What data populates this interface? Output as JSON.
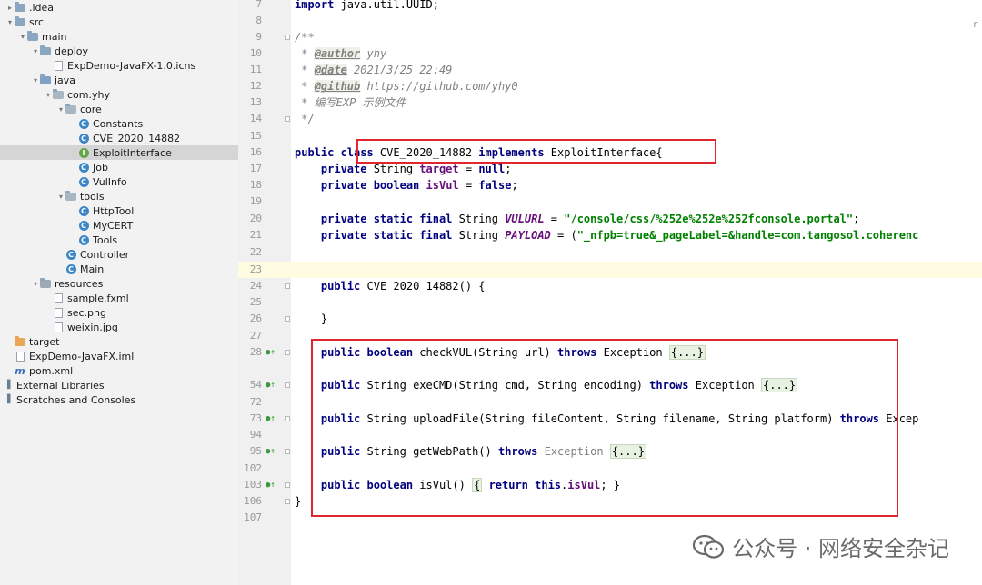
{
  "project_tree": [
    {
      "label": ".idea",
      "type": "folder",
      "depth": 0,
      "arrow": "right"
    },
    {
      "label": "src",
      "type": "folder",
      "depth": 0,
      "arrow": "down"
    },
    {
      "label": "main",
      "type": "folder",
      "depth": 1,
      "arrow": "down"
    },
    {
      "label": "deploy",
      "type": "folder",
      "depth": 2,
      "arrow": "down"
    },
    {
      "label": "ExpDemo-JavaFX-1.0.icns",
      "type": "file",
      "depth": 3,
      "arrow": ""
    },
    {
      "label": "java",
      "type": "src",
      "depth": 2,
      "arrow": "down"
    },
    {
      "label": "com.yhy",
      "type": "pkg",
      "depth": 3,
      "arrow": "down"
    },
    {
      "label": "core",
      "type": "pkg",
      "depth": 4,
      "arrow": "down"
    },
    {
      "label": "Constants",
      "type": "class",
      "depth": 5,
      "arrow": ""
    },
    {
      "label": "CVE_2020_14882",
      "type": "class",
      "depth": 5,
      "arrow": ""
    },
    {
      "label": "ExploitInterface",
      "type": "interface",
      "depth": 5,
      "arrow": "",
      "selected": true
    },
    {
      "label": "Job",
      "type": "class",
      "depth": 5,
      "arrow": ""
    },
    {
      "label": "VulInfo",
      "type": "class",
      "depth": 5,
      "arrow": ""
    },
    {
      "label": "tools",
      "type": "pkg",
      "depth": 4,
      "arrow": "down"
    },
    {
      "label": "HttpTool",
      "type": "class",
      "depth": 5,
      "arrow": ""
    },
    {
      "label": "MyCERT",
      "type": "class",
      "depth": 5,
      "arrow": ""
    },
    {
      "label": "Tools",
      "type": "class",
      "depth": 5,
      "arrow": ""
    },
    {
      "label": "Controller",
      "type": "class",
      "depth": 4,
      "arrow": ""
    },
    {
      "label": "Main",
      "type": "class",
      "depth": 4,
      "arrow": ""
    },
    {
      "label": "resources",
      "type": "res",
      "depth": 2,
      "arrow": "down"
    },
    {
      "label": "sample.fxml",
      "type": "file",
      "depth": 3,
      "arrow": ""
    },
    {
      "label": "sec.png",
      "type": "file",
      "depth": 3,
      "arrow": ""
    },
    {
      "label": "weixin.jpg",
      "type": "file",
      "depth": 3,
      "arrow": ""
    },
    {
      "label": "target",
      "type": "target",
      "depth": 0,
      "arrow": ""
    },
    {
      "label": "ExpDemo-JavaFX.iml",
      "type": "file",
      "depth": 0,
      "arrow": ""
    },
    {
      "label": "pom.xml",
      "type": "maven",
      "depth": 0,
      "arrow": ""
    },
    {
      "label": "External Libraries",
      "type": "lib",
      "depth": -1,
      "arrow": ""
    },
    {
      "label": "Scratches and Consoles",
      "type": "lib",
      "depth": -1,
      "arrow": ""
    }
  ],
  "editor": {
    "line_numbers": [
      "7",
      "8",
      "9",
      "10",
      "11",
      "12",
      "13",
      "14",
      "15",
      "16",
      "17",
      "18",
      "19",
      "20",
      "21",
      "22",
      "23",
      "24",
      "25",
      "26",
      "27",
      "28",
      "54",
      "72",
      "73",
      "94",
      "95",
      "102",
      "103",
      "106",
      "107"
    ],
    "lines": {
      "l7": {
        "kw": "import",
        "rest": " java.util.UUID;"
      },
      "l9": "/**",
      "l10": {
        "pre": " * ",
        "tag": "@author",
        "post": " yhy"
      },
      "l11": {
        "pre": " * ",
        "tag": "@date",
        "post": " 2021/3/25 22:49"
      },
      "l12": {
        "pre": " * ",
        "tag": "@github",
        "post": " https://github.com/yhy0"
      },
      "l13": " * 编写EXP 示例文件",
      "l14": " */",
      "l16": {
        "kw1": "public class",
        "name": " CVE_2020_14882 ",
        "kw2": "implements",
        "rest": " ExploitInterface{"
      },
      "l17": {
        "kw": "private",
        "type": " String ",
        "field": "target",
        "eq": " = ",
        "val": "null",
        "end": ";"
      },
      "l18": {
        "kw": "private boolean",
        "field": "isVul",
        "eq": " = ",
        "val": "false",
        "end": ";"
      },
      "l20": {
        "kw": "private static final",
        "type": " String ",
        "field": "VULURL",
        "eq": " = ",
        "str": "\"/console/css/%252e%252e%252fconsole.portal\"",
        "end": ";"
      },
      "l21": {
        "kw": "private static final",
        "type": " String ",
        "field": "PAYLOAD",
        "eq": " = (",
        "str": "\"_nfpb=true&_pageLabel=&handle=com.tangosol.coherenc"
      },
      "l24": {
        "kw": "public",
        "rest": " CVE_2020_14882() {"
      },
      "l26": "}",
      "l28": {
        "kw": "public boolean",
        "rest": " checkVUL(String url) ",
        "kw2": "throws",
        "rest2": " Exception ",
        "fold": "{...}"
      },
      "l54": {
        "kw": "public",
        "rest": " String exeCMD(String cmd, String encoding) ",
        "kw2": "throws",
        "rest2": " Exception ",
        "fold": "{...}"
      },
      "l73": {
        "kw": "public",
        "rest": " String uploadFile(String fileContent, String filename, String platform) ",
        "kw2": "throws",
        "rest2": " Excep"
      },
      "l95": {
        "kw": "public",
        "rest": " String getWebPath() ",
        "kw2": "throws",
        "rest2": " Exception ",
        "fold": "{...}"
      },
      "l103": {
        "kw": "public boolean",
        "rest": " isVul() ",
        "brace": "{",
        "kw2": "return this",
        "dot": ".",
        "field": "isVul",
        "end": "; }"
      },
      "l106": "}"
    }
  },
  "watermark": {
    "text": "公众号 · 网络安全杂记"
  },
  "top_right_mark": "r",
  "colors": {
    "redbox": "#e0262e",
    "keyword": "#000080",
    "string": "#008000",
    "field": "#660e7a"
  }
}
